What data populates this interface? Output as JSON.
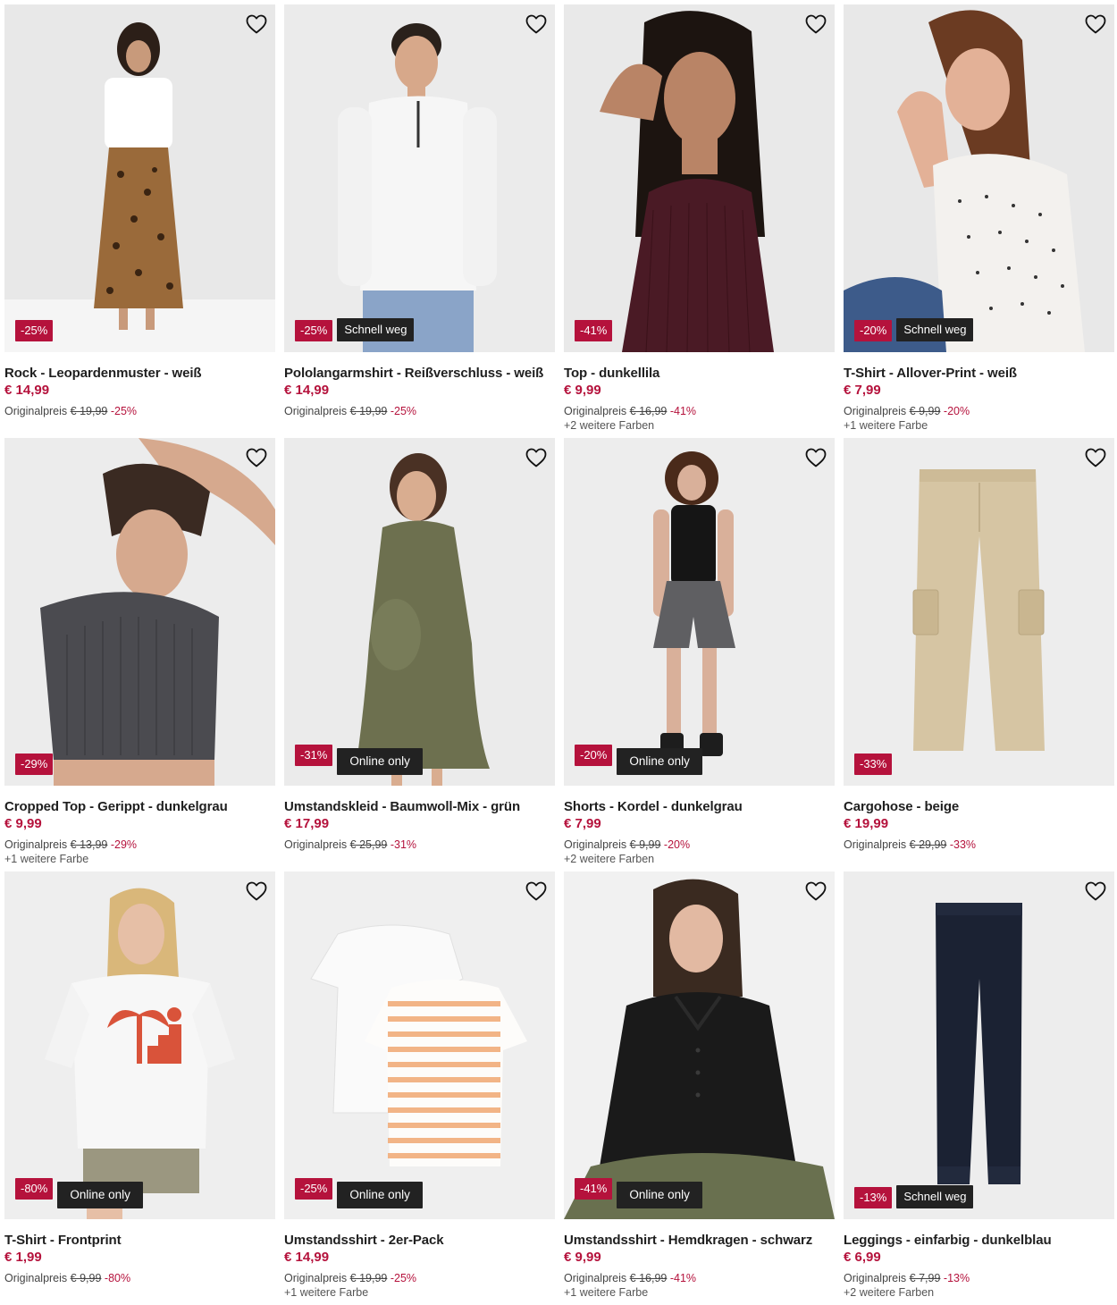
{
  "products": [
    {
      "title": "Rock - Leopardenmuster - weiß",
      "price": "€ 14,99",
      "orig_label": "Originalpreis",
      "orig_price": "€ 19,99",
      "orig_pct": "-25%",
      "badge_discount": "-25%",
      "badge_tag": "",
      "colors": "",
      "bg": "#ececec",
      "accent": "#8a5a2b"
    },
    {
      "title": "Pololangarmshirt - Reißverschluss - weiß",
      "price": "€ 14,99",
      "orig_label": "Originalpreis",
      "orig_price": "€ 19,99",
      "orig_pct": "-25%",
      "badge_discount": "-25%",
      "badge_tag": "Schnell weg",
      "colors": "",
      "bg": "#ededed",
      "accent": "#f4f4f4"
    },
    {
      "title": "Top - dunkellila",
      "price": "€ 9,99",
      "orig_label": "Originalpreis",
      "orig_price": "€ 16,99",
      "orig_pct": "-41%",
      "badge_discount": "-41%",
      "badge_tag": "",
      "colors": "+2 weitere Farben",
      "bg": "#eaeaea",
      "accent": "#4b1a24"
    },
    {
      "title": "T-Shirt - Allover-Print - weiß",
      "price": "€ 7,99",
      "orig_label": "Originalpreis",
      "orig_price": "€ 9,99",
      "orig_pct": "-20%",
      "badge_discount": "-20%",
      "badge_tag": "Schnell weg",
      "colors": "+1 weitere Farbe",
      "bg": "#e9e9e9",
      "accent": "#f2f0ec"
    },
    {
      "title": "Cropped Top - Gerippt - dunkelgrau",
      "price": "€ 9,99",
      "orig_label": "Originalpreis",
      "orig_price": "€ 13,99",
      "orig_pct": "-29%",
      "badge_discount": "-29%",
      "badge_tag": "",
      "colors": "+1 weitere Farbe",
      "bg": "#eeeeee",
      "accent": "#4a4a4e"
    },
    {
      "title": "Umstandskleid - Baumwoll-Mix - grün",
      "price": "€ 17,99",
      "orig_label": "Originalpreis",
      "orig_price": "€ 25,99",
      "orig_pct": "-31%",
      "badge_discount": "-31%",
      "badge_tag": "Online only",
      "colors": "",
      "bg": "#ececec",
      "accent": "#6b6e4f"
    },
    {
      "title": "Shorts - Kordel - dunkelgrau",
      "price": "€ 7,99",
      "orig_label": "Originalpreis",
      "orig_price": "€ 9,99",
      "orig_pct": "-20%",
      "badge_discount": "-20%",
      "badge_tag": "Online only",
      "colors": "+2 weitere Farben",
      "bg": "#eeeeee",
      "accent": "#5e5e60"
    },
    {
      "title": "Cargohose - beige",
      "price": "€ 19,99",
      "orig_label": "Originalpreis",
      "orig_price": "€ 29,99",
      "orig_pct": "-33%",
      "badge_discount": "-33%",
      "badge_tag": "",
      "colors": "",
      "bg": "#eeeeee",
      "accent": "#d8c7a6"
    },
    {
      "title": "T-Shirt - Frontprint",
      "price": "€ 1,99",
      "orig_label": "Originalpreis",
      "orig_price": "€ 9,99",
      "orig_pct": "-80%",
      "badge_discount": "-80%",
      "badge_tag": "Online only",
      "colors": "",
      "bg": "#efefef",
      "accent": "#f6f6f6"
    },
    {
      "title": "Umstandsshirt - 2er-Pack",
      "price": "€ 14,99",
      "orig_label": "Originalpreis",
      "orig_price": "€ 19,99",
      "orig_pct": "-25%",
      "badge_discount": "-25%",
      "badge_tag": "Online only",
      "colors": "+1 weitere Farbe",
      "bg": "#efefef",
      "accent": "#f2b88a"
    },
    {
      "title": "Umstandsshirt - Hemdkragen - schwarz",
      "price": "€ 9,99",
      "orig_label": "Originalpreis",
      "orig_price": "€ 16,99",
      "orig_pct": "-41%",
      "badge_discount": "-41%",
      "badge_tag": "Online only",
      "colors": "+1 weitere Farbe",
      "bg": "#f1f1f1",
      "accent": "#1a1a1a"
    },
    {
      "title": "Leggings - einfarbig - dunkelblau",
      "price": "€ 6,99",
      "orig_label": "Originalpreis",
      "orig_price": "€ 7,99",
      "orig_pct": "-13%",
      "badge_discount": "-13%",
      "badge_tag": "Schnell weg",
      "colors": "+2 weitere Farben",
      "bg": "#eeeeee",
      "accent": "#1b2233"
    }
  ],
  "colors": {
    "discount": "#b5123c",
    "tag": "#222222"
  },
  "icons": {
    "wishlist": "heart-outline-icon"
  }
}
